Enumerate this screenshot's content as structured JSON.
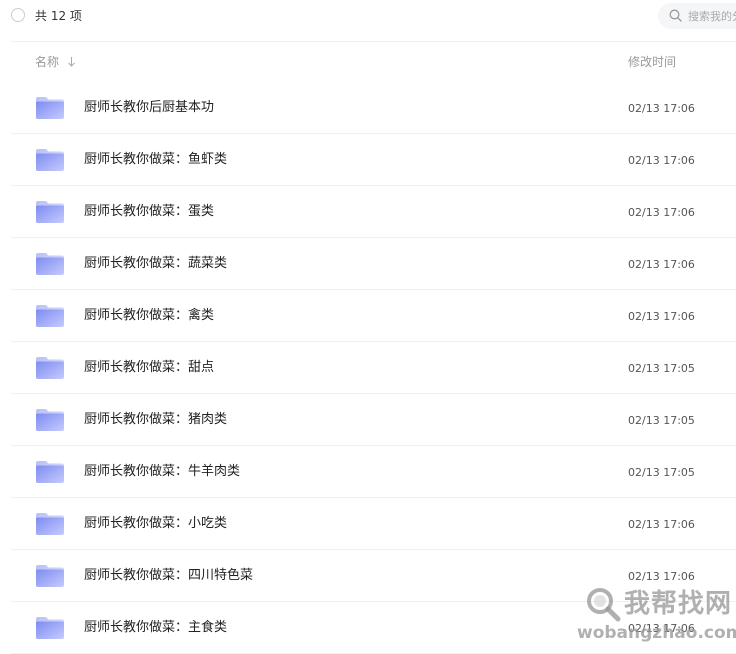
{
  "toolbar": {
    "count_label": "共 12 项",
    "search_placeholder": "搜索我的分享"
  },
  "header": {
    "name_label": "名称",
    "time_label": "修改时间"
  },
  "files": [
    {
      "name": "厨师长教你后厨基本功",
      "time": "02/13 17:06"
    },
    {
      "name": "厨师长教你做菜：鱼虾类",
      "time": "02/13 17:06"
    },
    {
      "name": "厨师长教你做菜：蛋类",
      "time": "02/13 17:06"
    },
    {
      "name": "厨师长教你做菜：蔬菜类",
      "time": "02/13 17:06"
    },
    {
      "name": "厨师长教你做菜：禽类",
      "time": "02/13 17:06"
    },
    {
      "name": "厨师长教你做菜：甜点",
      "time": "02/13 17:05"
    },
    {
      "name": "厨师长教你做菜：猪肉类",
      "time": "02/13 17:05"
    },
    {
      "name": "厨师长教你做菜：牛羊肉类",
      "time": "02/13 17:05"
    },
    {
      "name": "厨师长教你做菜：小吃类",
      "time": "02/13 17:06"
    },
    {
      "name": "厨师长教你做菜：四川特色菜",
      "time": "02/13 17:06"
    },
    {
      "name": "厨师长教你做菜：主食类",
      "time": "02/13 17:06"
    }
  ],
  "watermark": {
    "cn_text": "我帮找网",
    "url_text": "wobangzhao.com"
  },
  "icons": {
    "folder": "folder-icon",
    "search": "search-icon",
    "sort": "sort-arrow-down-icon"
  },
  "colors": {
    "folder_top": "#c5cbff",
    "folder_bottom": "#7f8cf0",
    "divider": "#eff0f2",
    "muted_text": "#999999"
  }
}
